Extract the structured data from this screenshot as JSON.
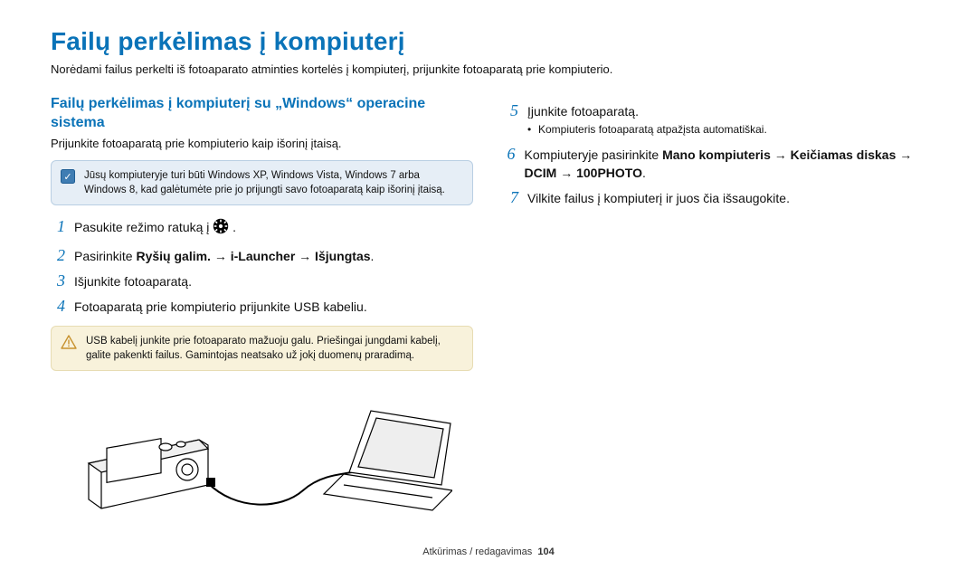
{
  "title": "Failų perkėlimas į kompiuterį",
  "intro": "Norėdami failus perkelti iš fotoaparato atminties kortelės į kompiuterį, prijunkite fotoaparatą prie kompiuterio.",
  "left": {
    "subheading": "Failų perkėlimas į kompiuterį su „Windows“ operacine sistema",
    "lead": "Prijunkite fotoaparatą prie kompiuterio kaip išorinį įtaisą.",
    "note": "Jūsų kompiuteryje turi būti Windows XP, Windows Vista, Windows 7 arba Windows 8, kad galėtumėte prie jo prijungti savo fotoaparatą kaip išorinį įtaisą.",
    "steps": {
      "s1": "Pasukite režimo ratuką į ",
      "s2_pre": "Pasirinkite ",
      "s2_bold": "Ryšių galim. → i-Launcher → Išjungtas",
      "s2_post": ".",
      "s3": "Išjunkite fotoaparatą.",
      "s4": "Fotoaparatą prie kompiuterio prijunkite USB kabeliu."
    },
    "warn": "USB kabelį junkite prie fotoaparato mažuoju galu. Priešingai jungdami kabelį, galite pakenkti failus. Gamintojas neatsako už jokį duomenų praradimą."
  },
  "right": {
    "steps": {
      "s5": "Įjunkite fotoaparatą.",
      "s5_sub": "Kompiuteris fotoaparatą atpažįsta automatiškai.",
      "s6_pre": "Kompiuteryje pasirinkite ",
      "s6_bold": "Mano kompiuteris → Keičiamas diskas → DCIM → 100PHOTO",
      "s6_post": ".",
      "s7": "Vilkite failus į kompiuterį ir juos čia išsaugokite."
    }
  },
  "footer": {
    "section": "Atkūrimas / redagavimas",
    "page": "104"
  }
}
